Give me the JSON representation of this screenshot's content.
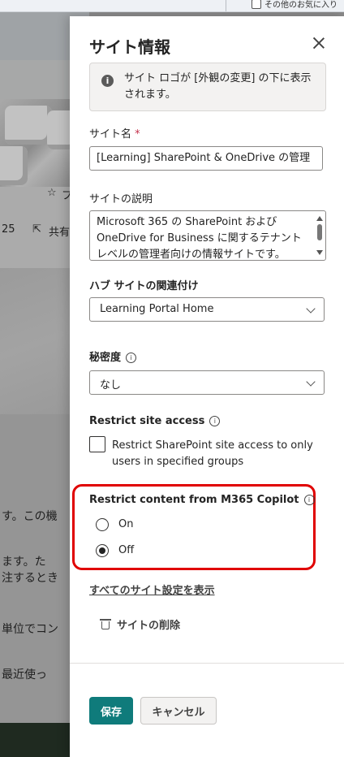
{
  "browser": {
    "favorites_label": "その他のお気に入り"
  },
  "background": {
    "follow_text": "フ",
    "count_text": "25",
    "share_text": "共有",
    "lines": [
      "す。この機",
      "ます。た",
      "注するとき",
      "単位でコン",
      "最近使っ"
    ]
  },
  "panel": {
    "title": "サイト情報",
    "info_message": "サイト ロゴが [外観の変更] の下に表示されます。",
    "site_name": {
      "label": "サイト名",
      "required_mark": "*",
      "value": "[Learning] SharePoint & OneDrive の管理"
    },
    "site_description": {
      "label": "サイトの説明",
      "value": "Microsoft 365 の SharePoint および OneDrive for Business に関するテナント レベルの管理者向けの情報サイトです。"
    },
    "hub": {
      "label": "ハブ サイトの関連付け",
      "selected": "Learning Portal Home"
    },
    "sensitivity": {
      "label": "秘密度",
      "selected": "なし"
    },
    "restrict_access": {
      "label": "Restrict site access",
      "checkbox_label": "Restrict SharePoint site access to only users in specified groups",
      "checked": false
    },
    "restrict_copilot": {
      "label": "Restrict content from M365 Copilot",
      "options": [
        "On",
        "Off"
      ],
      "selected": "Off"
    },
    "all_settings_link": "すべてのサイト設定を表示",
    "delete_label": "サイトの削除",
    "save_label": "保存",
    "cancel_label": "キャンセル"
  },
  "colors": {
    "primary": "#0f7b7b",
    "highlight": "#e00000",
    "required": "#c4314b"
  }
}
